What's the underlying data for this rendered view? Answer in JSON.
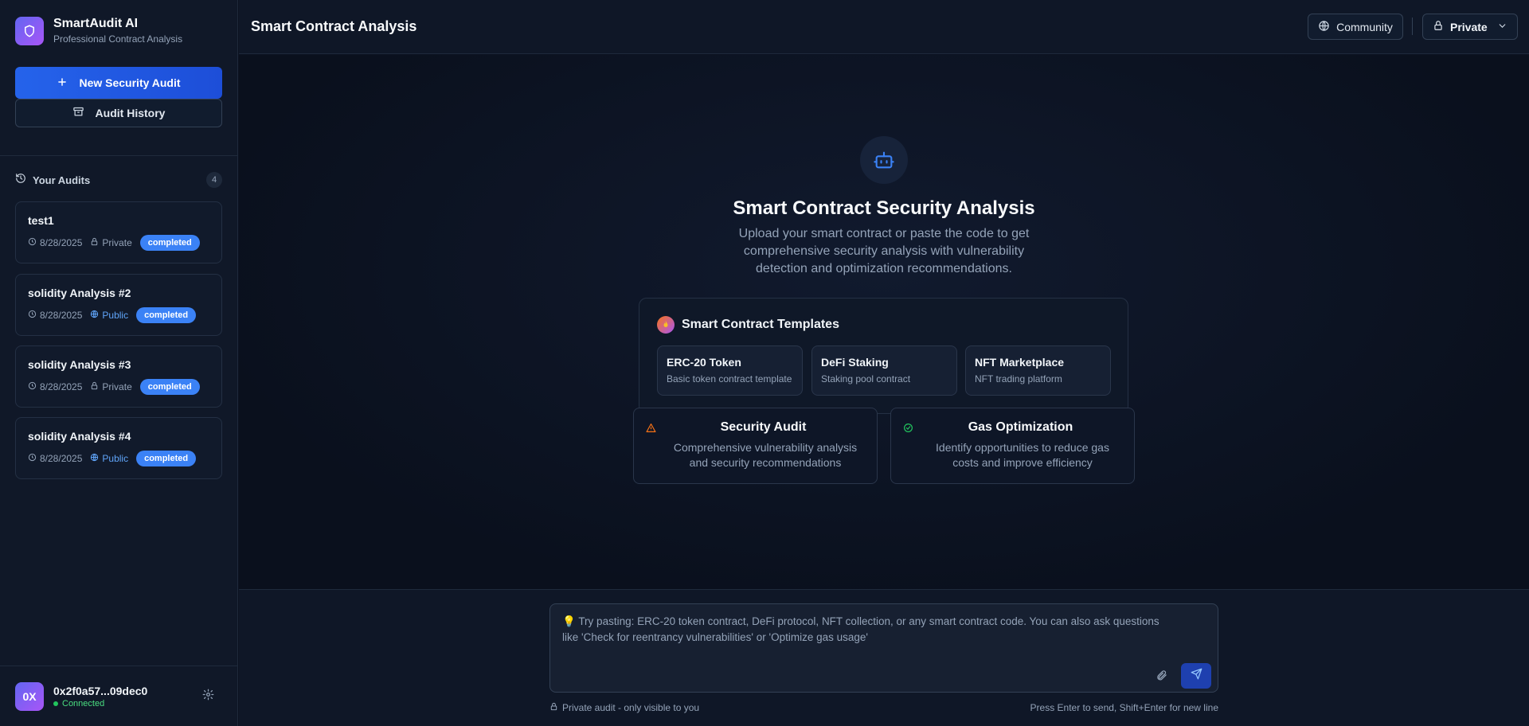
{
  "brand": {
    "name": "SmartAudit AI",
    "subtitle": "Professional Contract Analysis"
  },
  "sidebar": {
    "new_audit_label": "New Security Audit",
    "history_label": "Audit History",
    "audits_title": "Your Audits",
    "audits_count": "4",
    "audits": [
      {
        "name": "test1",
        "date": "8/28/2025",
        "visibility": "Private",
        "status": "completed"
      },
      {
        "name": "solidity Analysis #2",
        "date": "8/28/2025",
        "visibility": "Public",
        "status": "completed"
      },
      {
        "name": "solidity Analysis #3",
        "date": "8/28/2025",
        "visibility": "Private",
        "status": "completed"
      },
      {
        "name": "solidity Analysis #4",
        "date": "8/28/2025",
        "visibility": "Public",
        "status": "completed"
      }
    ]
  },
  "user": {
    "avatar_initials": "0X",
    "wallet": "0x2f0a57...09dec0",
    "status": "Connected"
  },
  "header": {
    "title": "Smart Contract Analysis",
    "community_label": "Community",
    "visibility_label": "Private"
  },
  "hero": {
    "title": "Smart Contract Security Analysis",
    "description": "Upload your smart contract or paste the code to get comprehensive security analysis with vulnerability detection and optimization recommendations."
  },
  "templates": {
    "title": "Smart Contract Templates",
    "items": [
      {
        "name": "ERC-20 Token",
        "description": "Basic token contract template"
      },
      {
        "name": "DeFi Staking",
        "description": "Staking pool contract"
      },
      {
        "name": "NFT Marketplace",
        "description": "NFT trading platform"
      }
    ]
  },
  "features": [
    {
      "title": "Security Audit",
      "description": "Comprehensive vulnerability analysis and security recommendations"
    },
    {
      "title": "Gas Optimization",
      "description": "Identify opportunities to reduce gas costs and improve efficiency"
    }
  ],
  "composer": {
    "placeholder": "💡 Try pasting: ERC-20 token contract, DeFi protocol, NFT collection, or any smart contract code. You can also ask questions like 'Check for reentrancy vulnerabilities' or 'Optimize gas usage'",
    "privacy_note": "Private audit - only visible to you",
    "hint": "Press Enter to send, Shift+Enter for new line"
  },
  "colors": {
    "accent": "#2563eb",
    "status_pill": "#3b82f6",
    "connected": "#22c55e",
    "warning": "#f97316",
    "success": "#22c55e"
  },
  "icons": [
    "shield-icon",
    "plus-icon",
    "archive-icon",
    "history-icon",
    "clock-icon",
    "lock-icon",
    "globe-icon",
    "settings-icon",
    "bot-icon",
    "flame-icon",
    "alert-triangle-icon",
    "check-circle-icon",
    "paperclip-icon",
    "send-icon",
    "chevron-down-icon"
  ]
}
